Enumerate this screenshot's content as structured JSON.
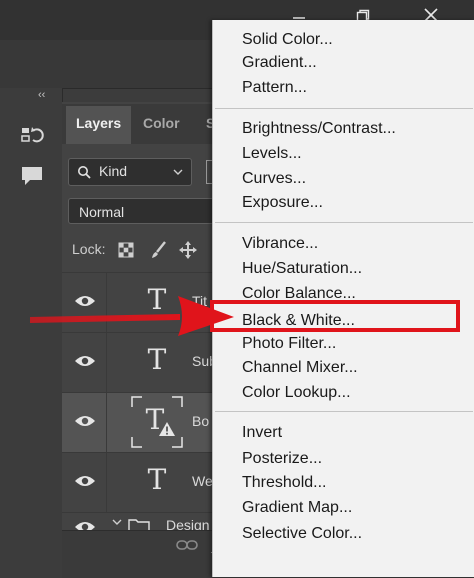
{
  "panel": {
    "tabs": [
      {
        "label": "Layers",
        "active": true
      },
      {
        "label": "Color",
        "active": false
      },
      {
        "label": "S",
        "active": false
      }
    ],
    "collapse_label": "‹‹",
    "filter_kind": "Kind",
    "blend_mode": "Normal",
    "lock_label": "Lock:",
    "layers": [
      {
        "name": "Tit",
        "type": "text"
      },
      {
        "name": "Sub",
        "type": "text"
      },
      {
        "name": "Bo",
        "type": "text-warning",
        "selected": true
      },
      {
        "name": "We",
        "type": "text"
      },
      {
        "name": "Design",
        "type": "group"
      }
    ]
  },
  "menu": {
    "groups": [
      [
        "Solid Color...",
        "Gradient...",
        "Pattern..."
      ],
      [
        "Brightness/Contrast...",
        "Levels...",
        "Curves...",
        "Exposure..."
      ],
      [
        "Vibrance...",
        "Hue/Saturation...",
        "Color Balance...",
        "Black & White...",
        "Photo Filter...",
        "Channel Mixer...",
        "Color Lookup..."
      ],
      [
        "Invert",
        "Posterize...",
        "Threshold...",
        "Gradient Map...",
        "Selective Color..."
      ]
    ],
    "highlighted_item": "Black & White..."
  },
  "colors": {
    "annotation_red": "#e0141b",
    "menu_bg": "#f2f2f2",
    "panel_bg": "#434343"
  },
  "icons": {
    "window": [
      "minimize-icon",
      "restore-icon",
      "close-icon"
    ],
    "lock": [
      "lock-pixels-icon",
      "lock-brush-icon",
      "lock-move-icon"
    ],
    "layer": [
      "eye-icon",
      "text-layer-icon",
      "warning-icon",
      "folder-icon"
    ]
  }
}
